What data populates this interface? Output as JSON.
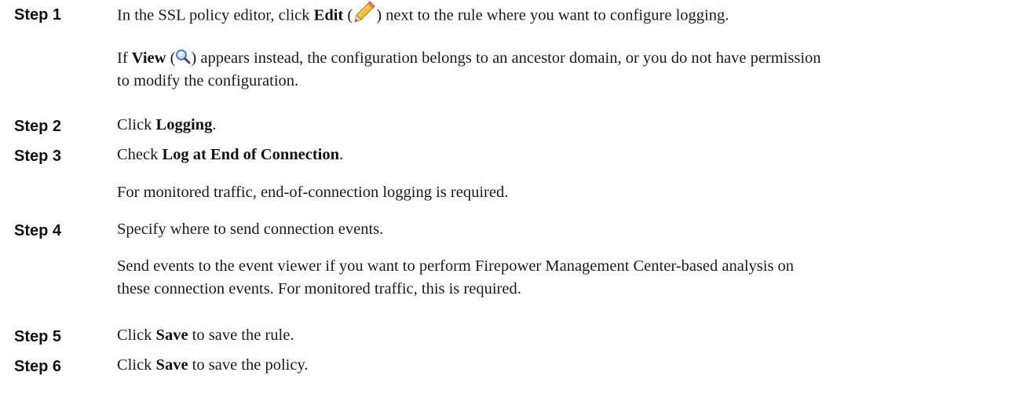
{
  "steps": [
    {
      "label": "Step 1",
      "line1": {
        "pre": "In the SSL policy editor, click ",
        "bold": "Edit",
        "paren_open": " (",
        "icon": "pencil-icon",
        "paren_close": ") next to the rule where you want to configure logging."
      },
      "note": {
        "pre": "If ",
        "bold": "View",
        "paren_open": " (",
        "icon": "magnifier-icon",
        "paren_close": ") appears instead, the configuration belongs to an ancestor domain, or you do not have permission",
        "line2": "to modify the configuration."
      }
    },
    {
      "label": "Step 2",
      "pre": "Click ",
      "bold": "Logging",
      "post": "."
    },
    {
      "label": "Step 3",
      "pre": "Check ",
      "bold": "Log at End of Connection",
      "post": ".",
      "note": "For monitored traffic, end-of-connection logging is required."
    },
    {
      "label": "Step 4",
      "text": "Specify where to send connection events.",
      "note_line1": "Send events to the event viewer if you want to perform Firepower Management Center-based analysis on",
      "note_line2": "these connection events. For monitored traffic, this is required."
    },
    {
      "label": "Step 5",
      "pre": "Click ",
      "bold": "Save",
      "post": " to save the rule."
    },
    {
      "label": "Step 6",
      "pre": "Click ",
      "bold": "Save",
      "post": " to save the policy."
    }
  ]
}
